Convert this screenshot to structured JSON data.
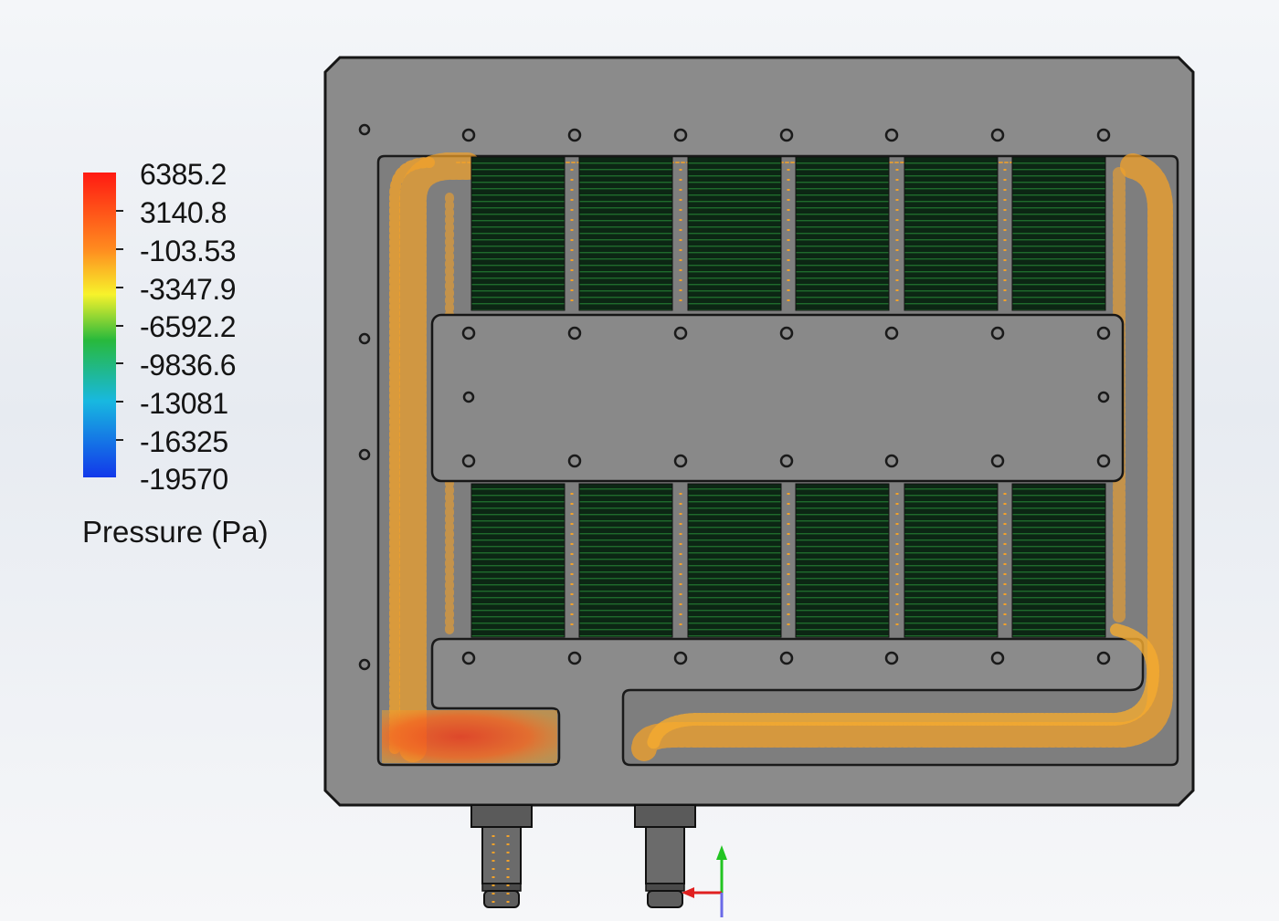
{
  "legend": {
    "title": "Pressure (Pa)",
    "values": [
      "6385.2",
      "3140.8",
      "-103.53",
      "-3347.9",
      "-6592.2",
      "-9836.6",
      "-13081",
      "-16325",
      "-19570"
    ],
    "colors": [
      "#ff1a12",
      "#ff8a1f",
      "#f7f22b",
      "#28b93c",
      "#18b8e0",
      "#1238ea"
    ]
  },
  "model": {
    "plate_color": "#8a8a8a",
    "fin_color": "#0b2a14",
    "flow_color": "#f3a22a",
    "hot_color": "#ef3e1c"
  }
}
